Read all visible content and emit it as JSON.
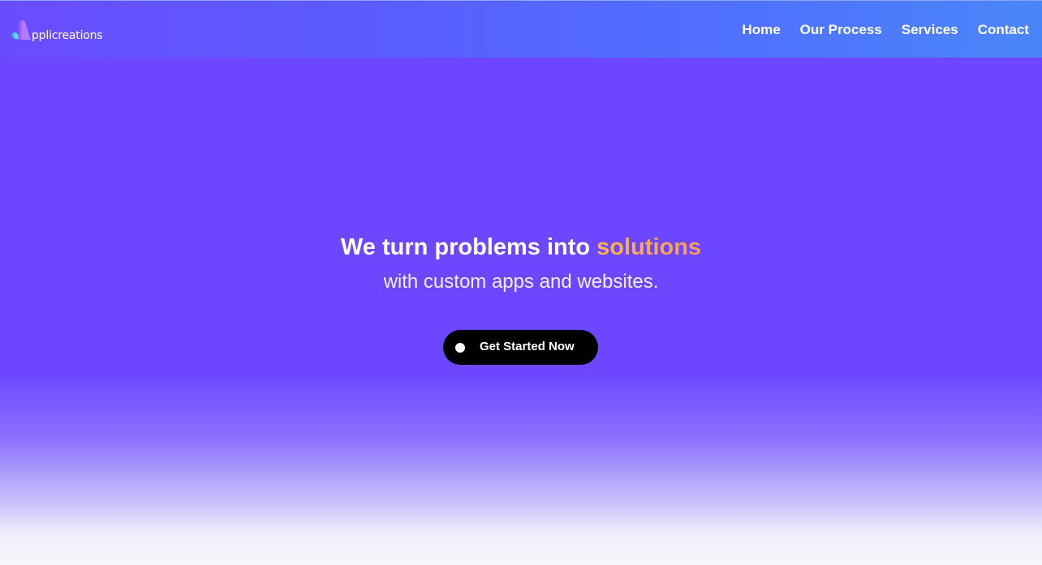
{
  "brand": {
    "logo_text": "pplicreations",
    "icon": "applicreations-logo-icon"
  },
  "nav": {
    "items": [
      {
        "label": "Home"
      },
      {
        "label": "Our Process"
      },
      {
        "label": "Services"
      },
      {
        "label": "Contact"
      }
    ]
  },
  "hero": {
    "headline_prefix": "We turn problems into ",
    "headline_highlight": "solutions",
    "subline": "with custom apps and websites.",
    "cta_label": "Get Started Now",
    "cta_icon": "dot-icon"
  },
  "colors": {
    "primary": "#6c47ff",
    "nav_gradient_end": "#4a86f8",
    "highlight": "#fba94f",
    "cta_background": "#000000"
  }
}
